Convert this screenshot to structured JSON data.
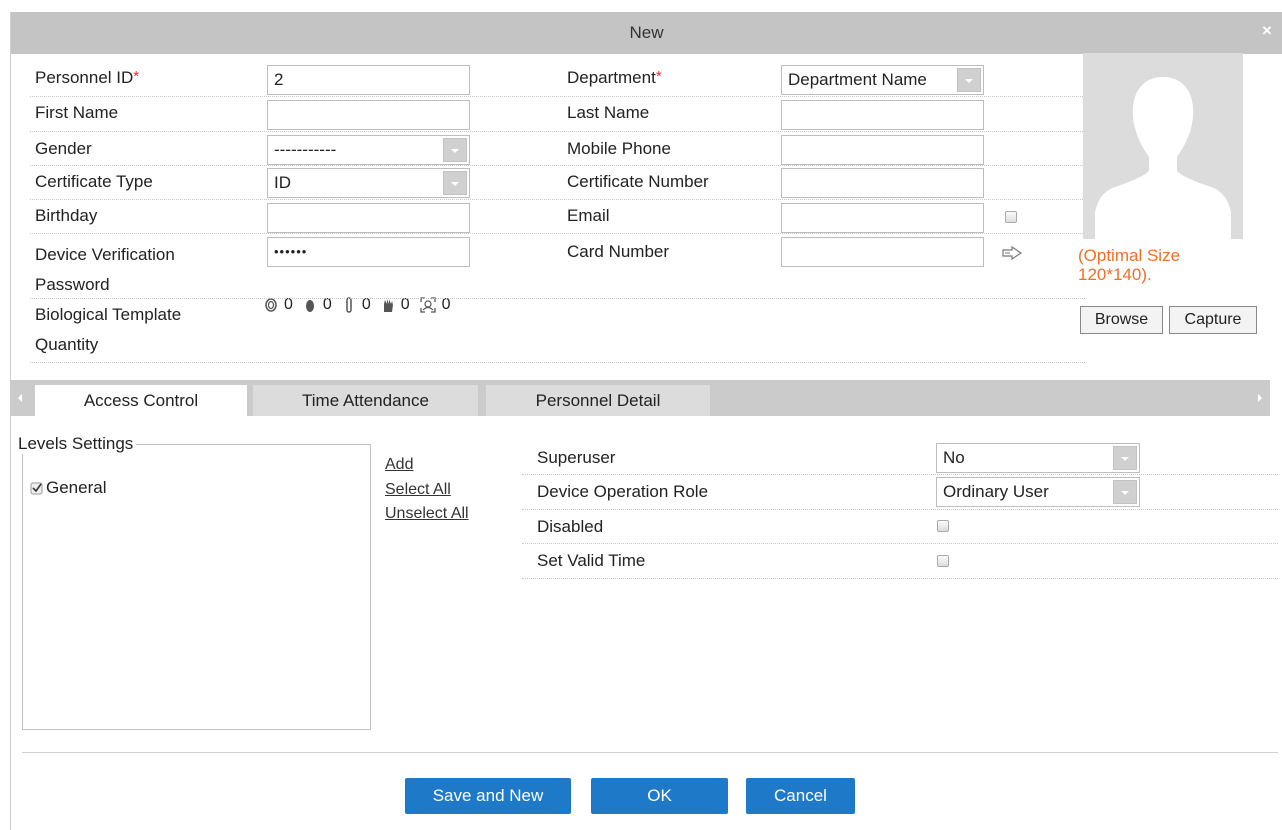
{
  "dialog": {
    "title": "New",
    "close_icon": "close-icon"
  },
  "form": {
    "personnel_id": {
      "label": "Personnel ID",
      "value": "2"
    },
    "first_name": {
      "label": "First Name",
      "value": ""
    },
    "gender": {
      "label": "Gender",
      "value": "-----------"
    },
    "certificate_type": {
      "label": "Certificate Type",
      "value": "ID"
    },
    "birthday": {
      "label": "Birthday",
      "value": ""
    },
    "device_password": {
      "label_line1": "Device Verification",
      "label_line2": "Password",
      "value": "••••••"
    },
    "bio_template": {
      "label_line1": "Biological Template",
      "label_line2": "Quantity",
      "counts": [
        "0",
        "0",
        "0",
        "0",
        "0"
      ]
    },
    "department": {
      "label": "Department",
      "value": "Department Name"
    },
    "last_name": {
      "label": "Last Name",
      "value": ""
    },
    "mobile_phone": {
      "label": "Mobile Phone",
      "value": ""
    },
    "certificate_number": {
      "label": "Certificate Number",
      "value": ""
    },
    "email": {
      "label": "Email",
      "value": ""
    },
    "card_number": {
      "label": "Card Number",
      "value": ""
    },
    "required_mark": "*"
  },
  "photo": {
    "note_line1": "(Optimal Size",
    "note_line2": "120*140).",
    "browse_label": "Browse",
    "capture_label": "Capture"
  },
  "tabs": [
    {
      "label": "Access Control",
      "active": true
    },
    {
      "label": "Time Attendance",
      "active": false
    },
    {
      "label": "Personnel Detail",
      "active": false
    }
  ],
  "access": {
    "levels_title": "Levels Settings",
    "levels": [
      {
        "label": "General",
        "checked": true
      }
    ],
    "links": {
      "add": "Add",
      "select_all": "Select All",
      "unselect_all": "Unselect All"
    },
    "superuser": {
      "label": "Superuser",
      "value": "No"
    },
    "device_role": {
      "label": "Device Operation Role",
      "value": "Ordinary User"
    },
    "disabled": {
      "label": "Disabled",
      "checked": false
    },
    "valid_time": {
      "label": "Set Valid Time",
      "checked": false
    }
  },
  "buttons": {
    "save_new": "Save and New",
    "ok": "OK",
    "cancel": "Cancel"
  },
  "colors": {
    "accent": "#1e79c8",
    "required": "#e03030",
    "note": "#f06e28",
    "titlebar": "#c4c4c4"
  }
}
